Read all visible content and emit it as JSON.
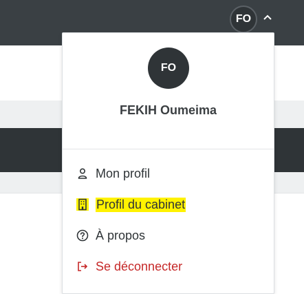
{
  "header": {
    "user_initials": "FO"
  },
  "dropdown": {
    "avatar_initials": "FO",
    "user_name": "FEKIH Oumeima",
    "items": [
      {
        "label": "Mon profil",
        "icon": "user-icon"
      },
      {
        "label": "Profil du cabinet",
        "icon": "building-icon"
      },
      {
        "label": "À propos",
        "icon": "help-circle-icon"
      },
      {
        "label": "Se déconnecter",
        "icon": "logout-icon"
      }
    ]
  },
  "colors": {
    "topbar": "#3a4044",
    "avatar": "#2f3437",
    "highlight": "#fff200",
    "logout": "#c62828"
  }
}
